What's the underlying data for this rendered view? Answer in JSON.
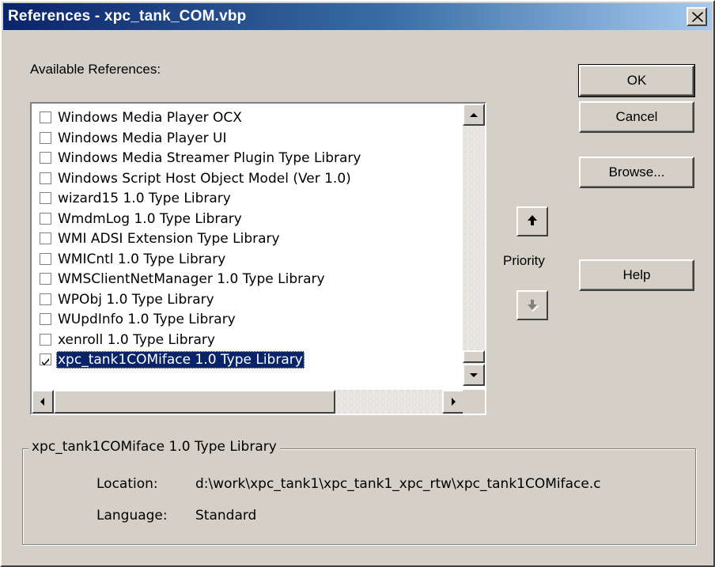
{
  "window": {
    "title": "References - xpc_tank_COM.vbp"
  },
  "available_label": "Available References:",
  "buttons": {
    "ok": "OK",
    "cancel": "Cancel",
    "browse": "Browse...",
    "help": "Help"
  },
  "priority_label": "Priority",
  "references": [
    {
      "label": "Windows Media Player OCX",
      "checked": false
    },
    {
      "label": "Windows Media Player UI",
      "checked": false
    },
    {
      "label": "Windows Media Streamer Plugin Type Library",
      "checked": false
    },
    {
      "label": "Windows Script Host Object Model (Ver 1.0)",
      "checked": false
    },
    {
      "label": "wizard15 1.0 Type Library",
      "checked": false
    },
    {
      "label": "WmdmLog 1.0 Type Library",
      "checked": false
    },
    {
      "label": "WMI ADSI Extension Type Library",
      "checked": false
    },
    {
      "label": "WMICntl 1.0 Type Library",
      "checked": false
    },
    {
      "label": "WMSClientNetManager 1.0 Type Library",
      "checked": false
    },
    {
      "label": "WPObj 1.0 Type Library",
      "checked": false
    },
    {
      "label": "WUpdInfo 1.0 Type Library",
      "checked": false
    },
    {
      "label": "xenroll 1.0 Type Library",
      "checked": false
    },
    {
      "label": "xpc_tank1COMiface 1.0 Type Library",
      "checked": true,
      "selected": true
    }
  ],
  "details": {
    "group_title": "xpc_tank1COMiface 1.0 Type Library",
    "location_label": "Location:",
    "location_value": "d:\\work\\xpc_tank1\\xpc_tank1_xpc_rtw\\xpc_tank1COMiface.c",
    "language_label": "Language:",
    "language_value": "Standard"
  },
  "colors": {
    "title_bar": "#0a246a",
    "face": "#d4d0c8",
    "selection": "#0a246a"
  },
  "icons": {
    "close": "close-icon",
    "up": "arrow-up-icon",
    "down": "arrow-down-icon"
  }
}
